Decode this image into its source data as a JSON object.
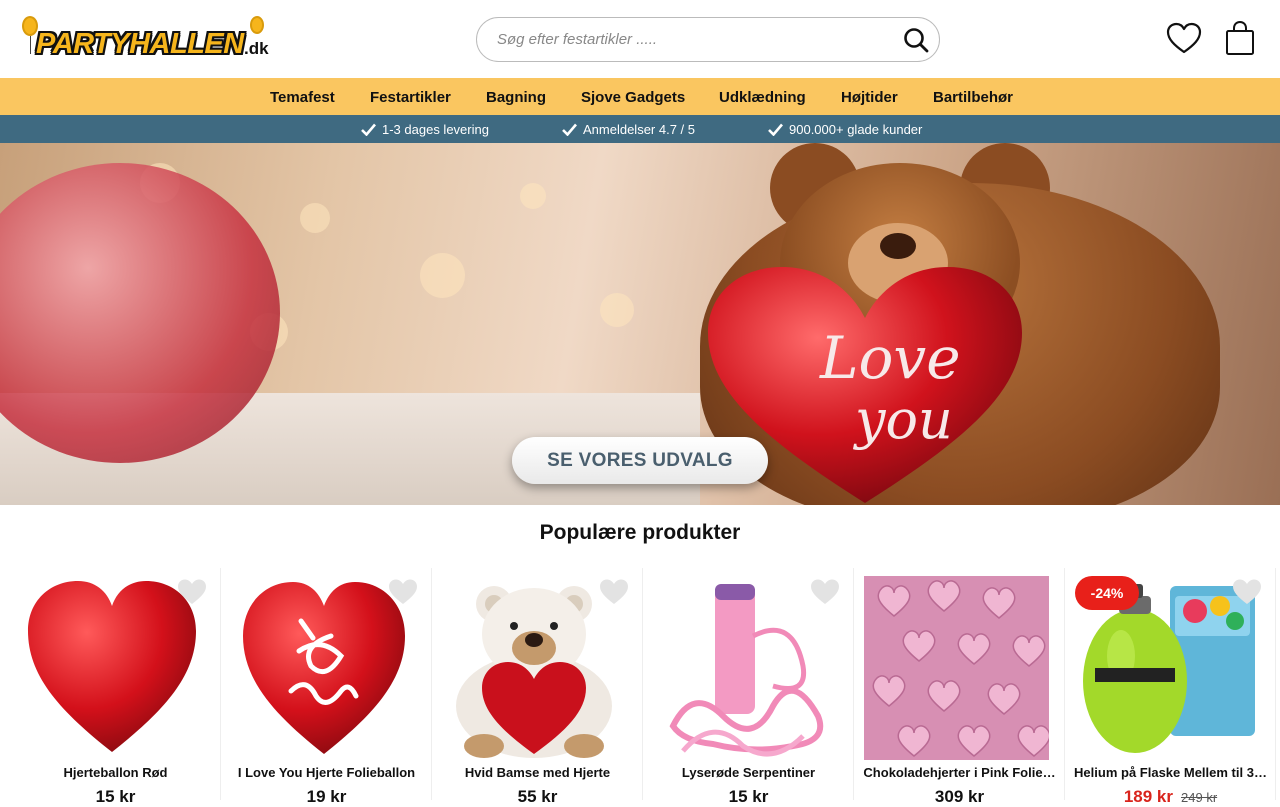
{
  "header": {
    "logo_text": "PARTYHALLEN",
    "logo_tld": ".dk",
    "search_placeholder": "Søg efter festartikler .....",
    "icons": [
      "search-icon",
      "heart-icon",
      "bag-icon"
    ]
  },
  "nav": {
    "items": [
      {
        "label": "Temafest"
      },
      {
        "label": "Festartikler"
      },
      {
        "label": "Bagning"
      },
      {
        "label": "Sjove Gadgets"
      },
      {
        "label": "Udklædning"
      },
      {
        "label": "Højtider"
      },
      {
        "label": "Bartilbehør"
      }
    ]
  },
  "usp": {
    "items": [
      {
        "label": "1-3 dages levering"
      },
      {
        "label": "Anmeldelser 4.7 / 5"
      },
      {
        "label": "900.000+ glade kunder"
      }
    ]
  },
  "hero": {
    "heart_text_line1": "Love",
    "heart_text_line2": "you",
    "cta_label": "SE VORES UDVALG"
  },
  "popular": {
    "title": "Populære produkter",
    "products": [
      {
        "name": "Hjerteballon Rød",
        "price": "15 kr"
      },
      {
        "name": "I Love You Hjerte Folieballon",
        "price": "19 kr"
      },
      {
        "name": "Hvid Bamse med Hjerte",
        "price": "55 kr"
      },
      {
        "name": "Lyserøde Serpentiner",
        "price": "15 kr"
      },
      {
        "name": "Chokoladehjerter i Pink Folie…",
        "price": "309 kr"
      },
      {
        "name": "Helium på Flaske Mellem til 3…",
        "price": "189 kr",
        "old_price": "249 kr",
        "badge": "-24%"
      }
    ]
  },
  "colors": {
    "nav_bg": "#fac660",
    "usp_bg": "#3f6a81",
    "sale_red": "#d9241c",
    "badge_red": "#e8201a"
  }
}
